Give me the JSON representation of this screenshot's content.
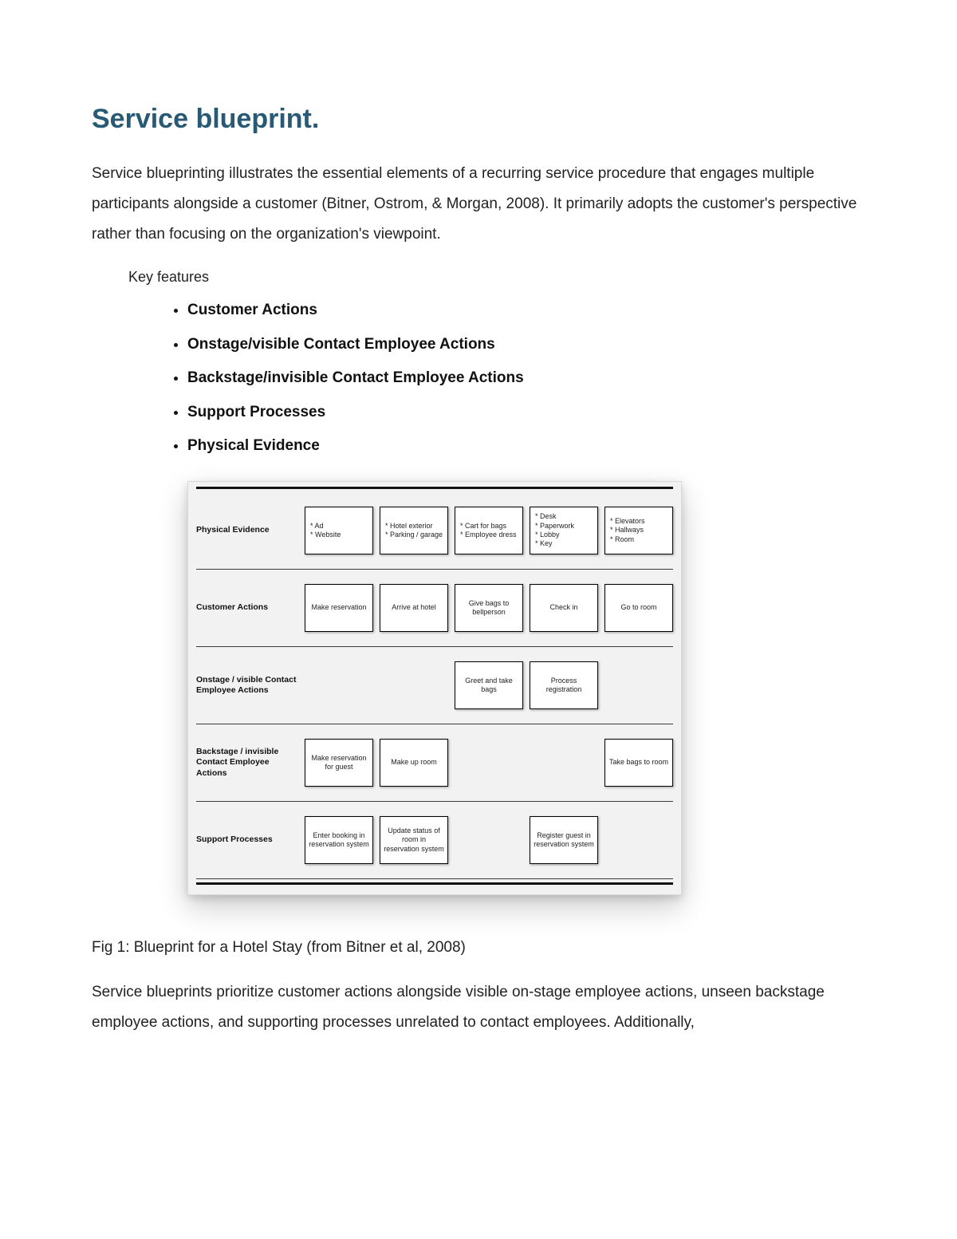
{
  "title": "Service blueprint.",
  "intro": "Service blueprinting illustrates the essential elements of a recurring service procedure that engages multiple participants alongside a customer (Bitner, Ostrom, & Morgan, 2008). It primarily adopts the customer's perspective rather than focusing on the organization's viewpoint.",
  "key_features_label": "Key features",
  "features": [
    "Customer Actions",
    "Onstage/visible Contact Employee Actions",
    "Backstage/invisible Contact Employee Actions",
    "Support Processes",
    "Physical Evidence"
  ],
  "blueprint": {
    "rows": [
      {
        "label": "Physical Evidence",
        "cells": [
          "* Ad\n* Website",
          "* Hotel exterior\n* Parking / garage",
          "* Cart for bags\n* Employee dress",
          "* Desk\n* Paperwork\n* Lobby\n* Key",
          "* Elevators\n* Hallways\n* Room"
        ]
      },
      {
        "label": "Customer Actions",
        "cells": [
          "Make reservation",
          "Arrive at hotel",
          "Give bags to bellperson",
          "Check in",
          "Go to room"
        ]
      },
      {
        "label": "Onstage / visible Contact Employee Actions",
        "cells": [
          "",
          "",
          "Greet and take bags",
          "Process registration",
          ""
        ]
      },
      {
        "label": "Backstage / invisible Contact Employee Actions",
        "cells": [
          "Make reservation for guest",
          "Make up room",
          "",
          "",
          "Take bags to room"
        ]
      },
      {
        "label": "Support Processes",
        "cells": [
          "Enter booking in reservation system",
          "Update status of room in reservation system",
          "",
          "Register guest in reservation system",
          ""
        ]
      }
    ]
  },
  "figure_caption": "Fig 1: Blueprint for a Hotel Stay (from Bitner et al, 2008)",
  "closing": "Service blueprints prioritize customer actions alongside visible on-stage employee actions, unseen backstage employee actions, and supporting processes unrelated to contact employees. Additionally,"
}
